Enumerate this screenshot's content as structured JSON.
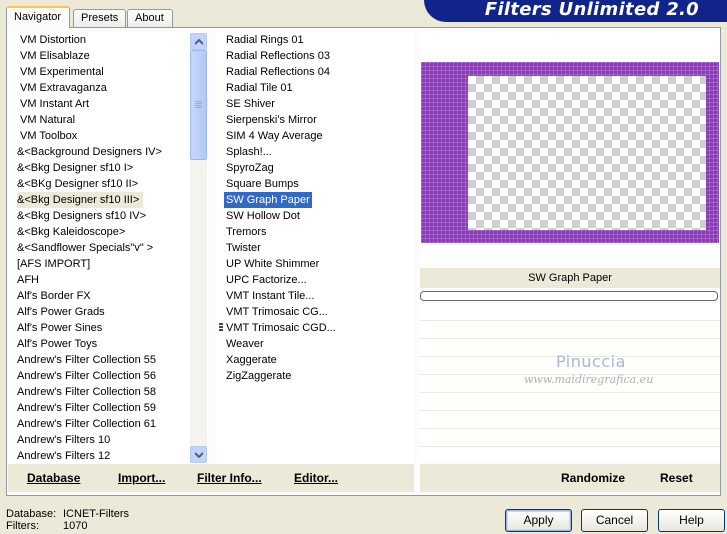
{
  "tabs": [
    "Navigator",
    "Presets",
    "About"
  ],
  "banner_title": "Filters Unlimited 2.0",
  "categories": [
    "VM Distortion",
    "VM Elisablaze",
    "VM Experimental",
    "VM Extravaganza",
    "VM Instant Art",
    "VM Natural",
    "VM Toolbox",
    "&<Background Designers IV>",
    "&<Bkg Designer sf10 I>",
    "&<BKg Designer sf10 II>",
    "&<Bkg Designer sf10 III>",
    "&<Bkg Designers sf10 IV>",
    "&<Bkg Kaleidoscope>",
    "&<Sandflower Specials\"v\" >",
    "[AFS IMPORT]",
    "AFH",
    "Alf's Border FX",
    "Alf's Power Grads",
    "Alf's Power Sines",
    "Alf's Power Toys",
    "Andrew's Filter Collection 55",
    "Andrew's Filter Collection 56",
    "Andrew's Filter Collection 58",
    "Andrew's Filter Collection 59",
    "Andrew's Filter Collection 61",
    "Andrew's Filters 10",
    "Andrew's Filters 12"
  ],
  "highlighted_category_index": 10,
  "filters": [
    "Radial  Rings 01",
    "Radial Reflections 03",
    "Radial Reflections 04",
    "Radial Tile 01",
    "SE Shiver",
    "Sierpenski's Mirror",
    "SIM 4 Way Average",
    "Splash!...",
    "SpyroZag",
    "Square Bumps",
    "SW Graph Paper",
    "SW Hollow Dot",
    "Tremors",
    "Twister",
    "UP White Shimmer",
    "UPC Factorize...",
    "VMT Instant Tile...",
    "VMT Trimosaic CG...",
    "VMT Trimosaic CGD...",
    "Weaver",
    "Xaggerate",
    "ZigZaggerate"
  ],
  "selected_filter_index": 10,
  "preview": {
    "filter_name": "SW Graph Paper",
    "watermark_name": "Pinuccia",
    "watermark_url": "www.maidiregrafica.eu",
    "border_color": "#8a3bb8"
  },
  "toolbar": {
    "database": "Database",
    "import": "Import...",
    "filter_info": "Filter Info...",
    "editor": "Editor...",
    "randomize": "Randomize",
    "reset": "Reset"
  },
  "status": {
    "database_label": "Database:",
    "database_value": "ICNET-Filters",
    "filters_label": "Filters:",
    "filters_value": "1070"
  },
  "buttons": {
    "apply": "Apply",
    "cancel": "Cancel",
    "help": "Help"
  },
  "colors": {
    "selection": "#316ac5",
    "banner": "#10248c",
    "window": "#ece9d8"
  }
}
